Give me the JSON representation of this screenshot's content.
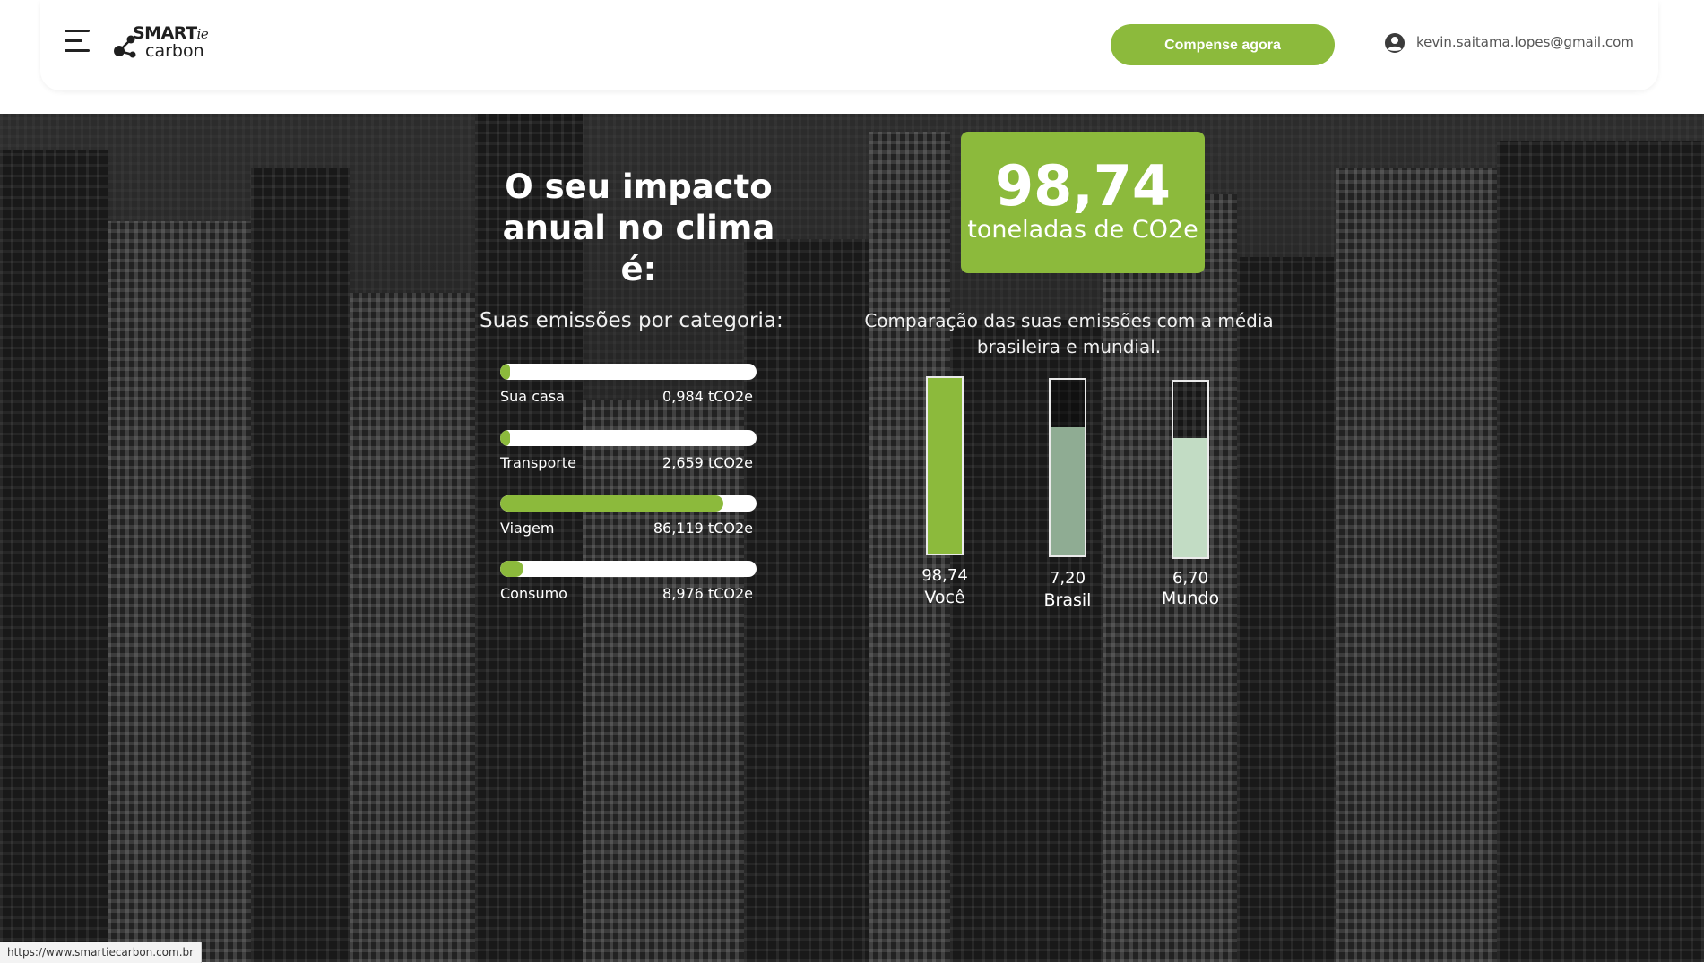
{
  "header": {
    "logo_top": "SMART",
    "logo_top_suffix": "ie",
    "logo_bottom": "carbon",
    "cta_label": "Compense agora",
    "user_email": "kevin.saitama.lopes@gmail.com"
  },
  "hero": {
    "title_line1": "O seu impacto",
    "title_line2": "anual no clima é:",
    "total_value": "98,74",
    "total_unit": "toneladas de CO2e"
  },
  "categories": {
    "heading": "Suas emissões por categoria:",
    "items": [
      {
        "label": "Sua casa",
        "value": "0,984 tCO2e",
        "fill_fraction": 0.01
      },
      {
        "label": "Transporte",
        "value": "2,659 tCO2e",
        "fill_fraction": 0.03
      },
      {
        "label": "Viagem",
        "value": "86,119 tCO2e",
        "fill_fraction": 0.87
      },
      {
        "label": "Consumo",
        "value": "8,976 tCO2e",
        "fill_fraction": 0.09
      }
    ]
  },
  "comparison": {
    "heading": "Comparação das suas emissões com a média brasileira e mundial.",
    "bars": [
      {
        "value": "98,74",
        "label": "Você",
        "fill_fraction": 1.0,
        "color": "#8cba3c"
      },
      {
        "value": "7,20",
        "label": "Brasil",
        "fill_fraction": 0.73,
        "color": "#8fac93"
      },
      {
        "value": "6,70",
        "label": "Mundo",
        "fill_fraction": 0.68,
        "color": "#c2dcc4"
      }
    ]
  },
  "status_bar": {
    "url": "https://www.smartiecarbon.com.br"
  },
  "colors": {
    "accent": "#8cba3c"
  }
}
